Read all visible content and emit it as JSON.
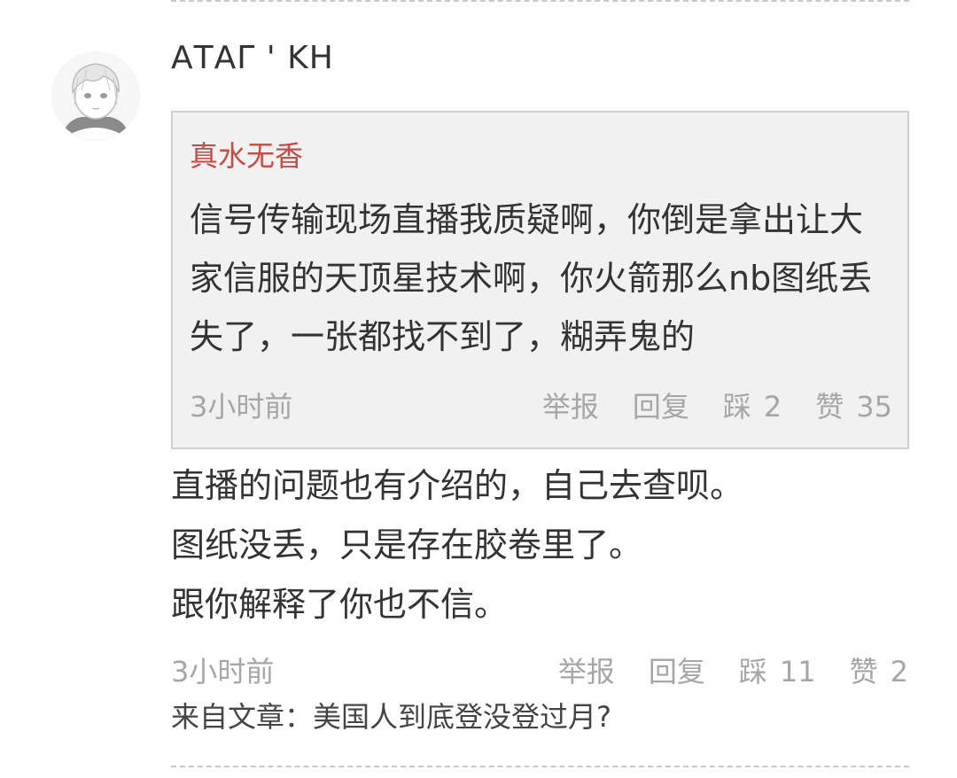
{
  "comment": {
    "avatar_icon": "anime-avatar-icon",
    "username": "ΑΤΑΓ ' ΚΗ",
    "quote": {
      "author": "真水无香",
      "text": "信号传输现场直播我质疑啊，你倒是拿出让大家信服的天顶星技术啊，你火箭那么nb图纸丢失了，一张都找不到了，糊弄鬼的",
      "time": "3小时前",
      "report_label": "举报",
      "reply_label": "回复",
      "dislike_label": "踩",
      "dislike_count": "2",
      "like_label": "赞",
      "like_count": "35"
    },
    "reply_lines": [
      "直播的问题也有介绍的，自己去查呗。",
      "图纸没丢，只是存在胶卷里了。",
      "跟你解释了你也不信。"
    ],
    "time": "3小时前",
    "report_label": "举报",
    "reply_label": "回复",
    "dislike_label": "踩",
    "dislike_count": "11",
    "like_label": "赞",
    "like_count": "2",
    "source": "来自文章：美国人到底登没登过月?"
  },
  "colors": {
    "author_red": "#c84a45",
    "meta_gray": "#a6a6a6",
    "quote_bg": "#f1f1f1",
    "quote_border": "#cfcfcf"
  }
}
